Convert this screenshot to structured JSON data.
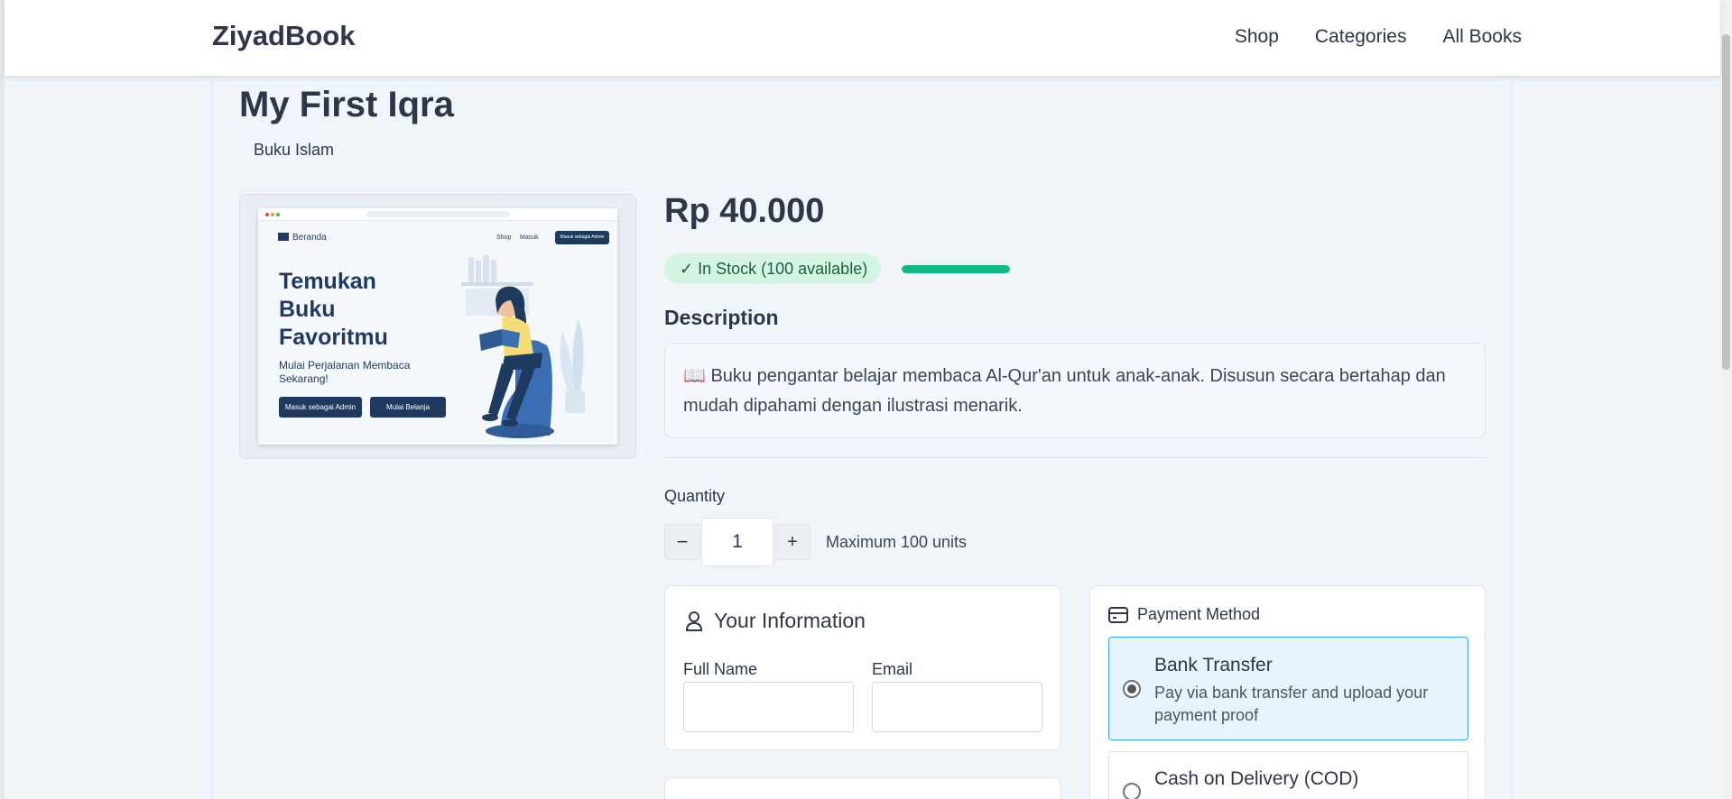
{
  "navbar": {
    "brand": "ZiyadBook",
    "links": [
      "Shop",
      "Categories",
      "All Books"
    ]
  },
  "product": {
    "title": "My First Iqra",
    "category": "Buku Islam",
    "price": "Rp 40.000",
    "stock_label": "In Stock (100 available)",
    "stock_level_pct": 100,
    "description_heading": "Description",
    "description": "📖 Buku pengantar belajar membaca Al-Qur'an untuk anak-anak. Disusun secara bertahap dan mudah dipahami dengan ilustrasi menarik."
  },
  "preview_image": {
    "logo": "Beranda",
    "nav": [
      "Shop",
      "Masuk"
    ],
    "admin_button": "Masuk sebagai Admin",
    "hero_title": "Temukan Buku Favoritmu",
    "hero_subtitle": "Mulai Perjalanan Membaca Sekarang!",
    "button_admin": "Masuk sebagai Admin",
    "button_shop": "Mulai Belanja"
  },
  "quantity": {
    "label": "Quantity",
    "value": "1",
    "minus": "−",
    "plus": "+",
    "max_note": "Maximum 100 units"
  },
  "info_form": {
    "title": "Your Information",
    "full_name_label": "Full Name",
    "email_label": "Email"
  },
  "payment": {
    "title": "Payment Method",
    "options": [
      {
        "name": "Bank Transfer",
        "description": "Pay via bank transfer and upload your payment proof",
        "selected": true
      },
      {
        "name": "Cash on Delivery (COD)",
        "selected": false
      }
    ]
  },
  "colors": {
    "accent": "#3ba3e6",
    "stock_green": "#10b981",
    "text": "#2d3748"
  }
}
